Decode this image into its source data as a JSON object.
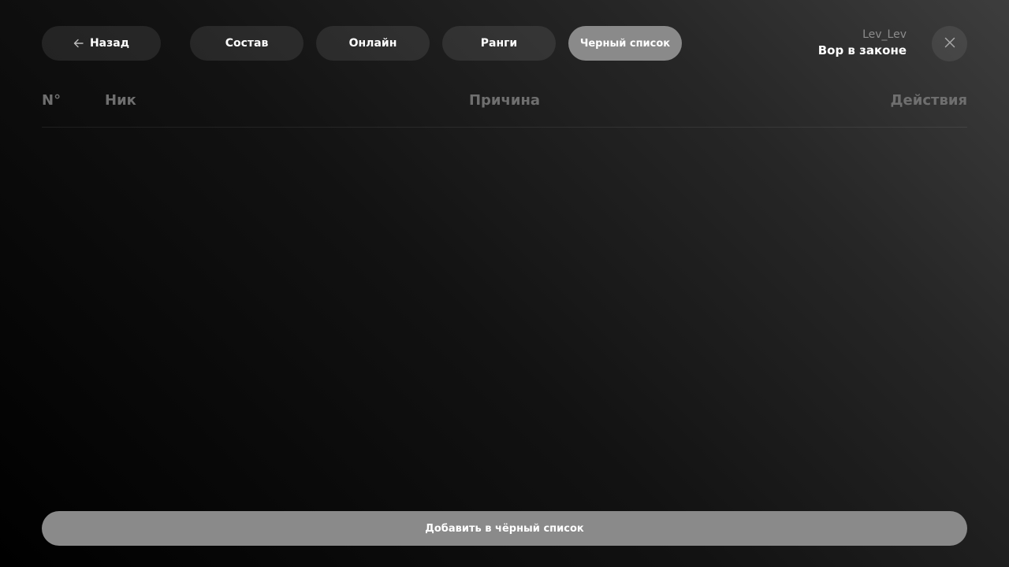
{
  "nav": {
    "back_label": "Назад",
    "tabs": [
      {
        "label": "Состав"
      },
      {
        "label": "Онлайн"
      },
      {
        "label": "Ранги"
      },
      {
        "label": "Черный список",
        "active": true
      }
    ]
  },
  "user": {
    "nickname": "Lev_Lev",
    "rank": "Вор в законе"
  },
  "icons": {
    "back": "arrow-left-icon",
    "close": "close-icon"
  },
  "table": {
    "columns": {
      "number": "N°",
      "nick": "Ник",
      "reason": "Причина",
      "actions": "Действия"
    },
    "rows": []
  },
  "actions": {
    "add_label": "Добавить в чёрный список"
  },
  "colors": {
    "active_tab": "#8a8a8a",
    "pill_bg": "rgba(255,255,255,0.09)",
    "header_text": "#6f6f6f"
  }
}
